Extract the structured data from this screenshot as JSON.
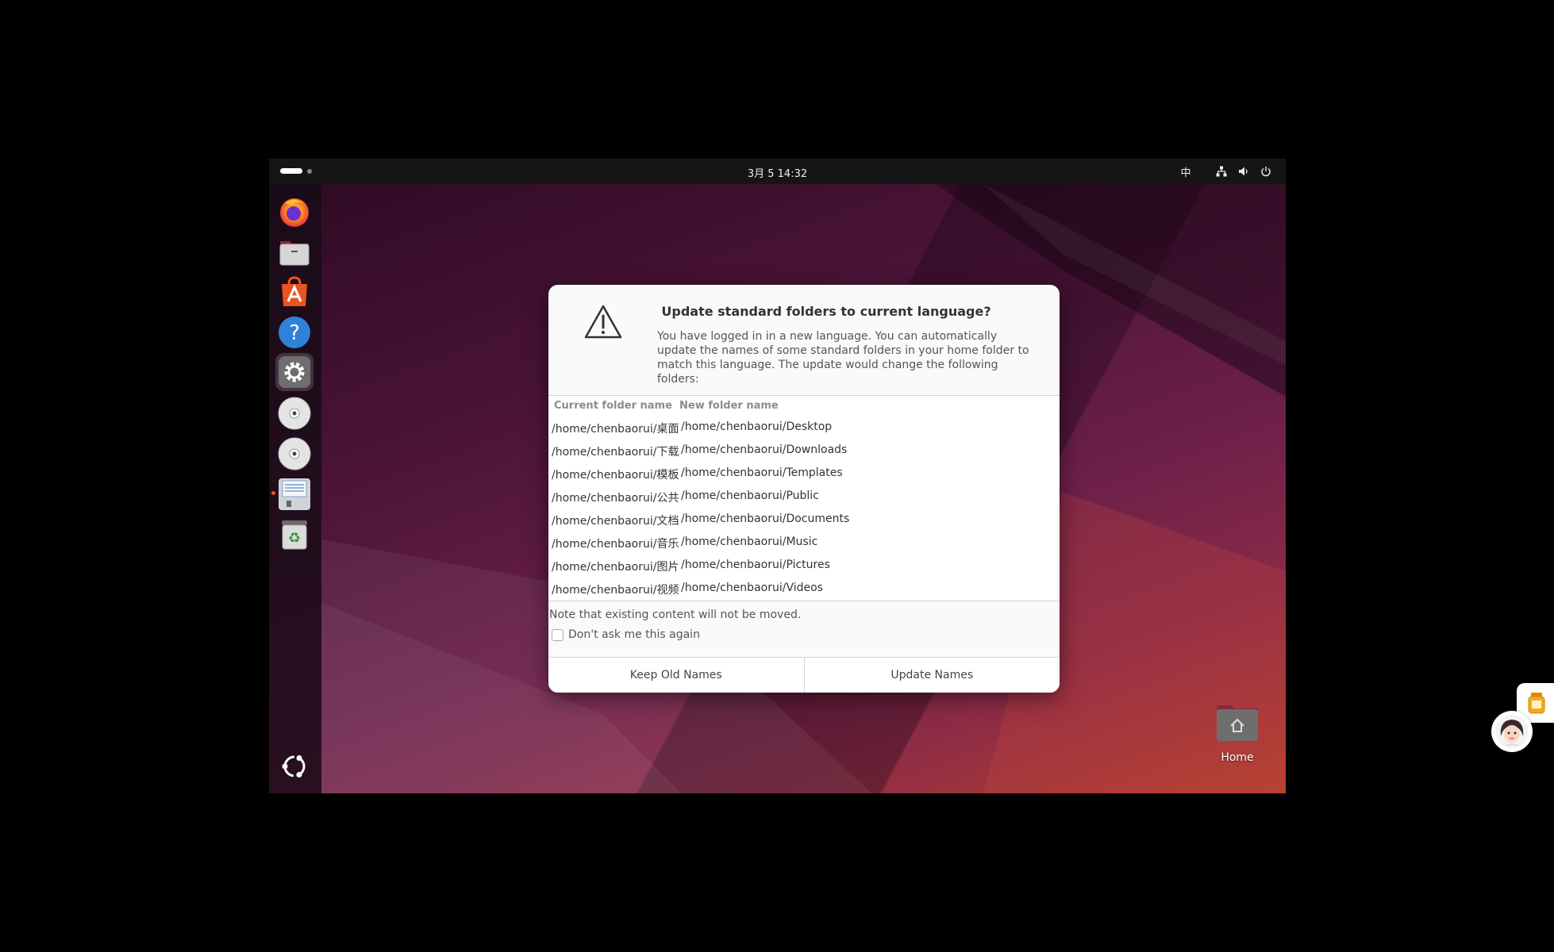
{
  "topbar": {
    "clock": "3月 5  14:32",
    "input_method": "中",
    "icons": [
      "network-icon",
      "volume-icon",
      "power-icon"
    ]
  },
  "dock": {
    "apps": [
      {
        "name": "Firefox",
        "icon": "firefox-icon"
      },
      {
        "name": "Files",
        "icon": "files-icon"
      },
      {
        "name": "App Center",
        "icon": "app-center-icon"
      },
      {
        "name": "Help",
        "icon": "help-icon"
      },
      {
        "name": "Settings",
        "icon": "settings-icon",
        "active": true
      },
      {
        "name": "Disc",
        "icon": "disc-icon"
      },
      {
        "name": "Disc",
        "icon": "disc-icon"
      },
      {
        "name": "Floppy",
        "icon": "floppy-icon"
      },
      {
        "name": "Trash",
        "icon": "trash-icon"
      }
    ],
    "show_apps_icon": "ubuntu-logo-icon"
  },
  "dialog": {
    "title": "Update standard folders to current language?",
    "message": "You have logged in in a new language. You can automatically update the names of some standard folders in your home folder to match this language. The update would change the following folders:",
    "columns": [
      "Current folder name",
      "New folder name"
    ],
    "rows": [
      [
        "/home/chenbaorui/桌面",
        "/home/chenbaorui/Desktop"
      ],
      [
        "/home/chenbaorui/下载",
        "/home/chenbaorui/Downloads"
      ],
      [
        "/home/chenbaorui/模板",
        "/home/chenbaorui/Templates"
      ],
      [
        "/home/chenbaorui/公共",
        "/home/chenbaorui/Public"
      ],
      [
        "/home/chenbaorui/文档",
        "/home/chenbaorui/Documents"
      ],
      [
        "/home/chenbaorui/音乐",
        "/home/chenbaorui/Music"
      ],
      [
        "/home/chenbaorui/图片",
        "/home/chenbaorui/Pictures"
      ],
      [
        "/home/chenbaorui/视频",
        "/home/chenbaorui/Videos"
      ]
    ],
    "note": "Note that existing content will not be moved.",
    "checkbox_label": "Don't ask me this again",
    "checkbox_checked": false,
    "buttons": {
      "keep": "Keep Old Names",
      "update": "Update Names"
    }
  },
  "desktop": {
    "home_label": "Home"
  },
  "colors": {
    "accent": "#e95420",
    "topbar": "#151515",
    "dialog_bg": "#fafafa"
  }
}
